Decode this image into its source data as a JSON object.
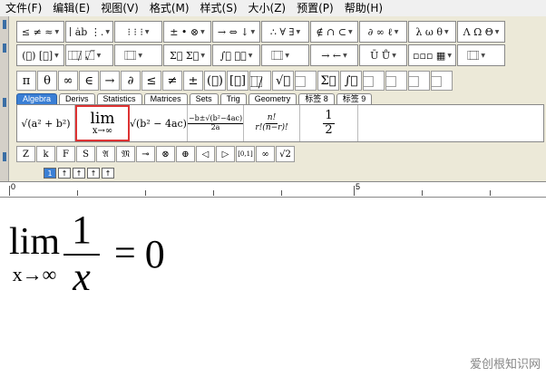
{
  "menu": [
    "文件(F)",
    "编辑(E)",
    "视图(V)",
    "格式(M)",
    "样式(S)",
    "大小(Z)",
    "预置(P)",
    "帮助(H)"
  ],
  "palette_row1": [
    "≤ ≠ ≈",
    "∣ ȧb ⋮.",
    "⁝ ⁝ ⁝",
    "± • ⊗",
    "→ ⇔ ↓",
    "∴ ∀ ∃",
    "∉ ∩ ⊂",
    "∂ ∞ ℓ",
    "λ ω θ",
    "Λ Ω Θ"
  ],
  "palette_row2": [
    "(⃞) [⃞]",
    "⃞/⃞ √⃞",
    "⃞ ⃞",
    "Σ⃞ Σ⃞",
    "∫⃞ ∮⃞",
    "⃞ ⃞",
    "→ ←",
    "Ū Ů",
    "▫▫▫ ▦",
    "⃞ ⃞"
  ],
  "symbol_row": [
    "π",
    "θ",
    "∞",
    "∈",
    "→",
    "∂",
    "≤",
    "≠",
    "±",
    "(⃞)",
    "[⃞]",
    "⃞/⃞",
    "√⃞",
    "⃞",
    "Σ⃞",
    "∫⃞",
    "⃞",
    "⃞",
    "⃞",
    "⃞"
  ],
  "tabs": [
    "Algebra",
    "Derivs",
    "Statistics",
    "Matrices",
    "Sets",
    "Trig",
    "Geometry",
    "标签 8",
    "标签 9"
  ],
  "templates": {
    "t1": "√(a² + b²)",
    "t2_main": "lim",
    "t2_sub": "x→∞",
    "t3": "√(b² − 4ac)",
    "t4_num": "−b±√(b²−4ac)",
    "t4_den": "2a",
    "t5_num": "n!",
    "t5_den": "r!(n−r)!",
    "t6_num": "1",
    "t6_den": "2"
  },
  "small_row": [
    "Z",
    "k",
    "F",
    "S",
    "𝔄",
    "𝔐",
    "⊸",
    "⊗",
    "⊕",
    "◁",
    "▷",
    "[0,1]",
    "∞",
    "√2"
  ],
  "size_buttons": [
    "1",
    "↑",
    "↑",
    "↑",
    "↑"
  ],
  "ruler": {
    "label_0": "0",
    "label_5": "5"
  },
  "equation": {
    "lim": "lim",
    "sub": "x→∞",
    "numerator": "1",
    "denominator": "x",
    "equals": "=",
    "rhs": "0"
  },
  "watermark": "爱创根知识网",
  "colors": {
    "tab_active": "#3a7fd5",
    "selected_border": "#d33333",
    "toolbar_bg": "#ece9d8"
  }
}
